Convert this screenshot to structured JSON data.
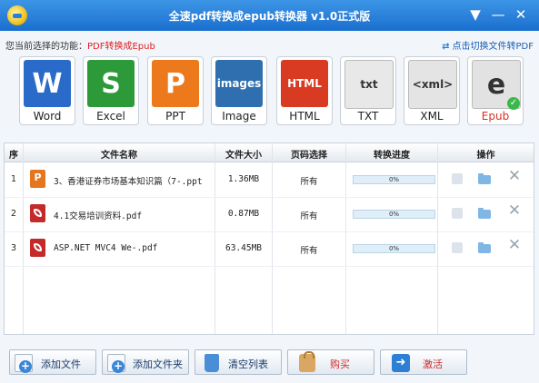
{
  "app": {
    "title": "全速pdf转换成epub转换器 v1.0正式版"
  },
  "function_bar": {
    "label": "您当前选择的功能：",
    "current": "PDF转换成Epub",
    "switch_link": "点击切换文件转PDF"
  },
  "formats": [
    {
      "name": "Word",
      "color": "#2a6bc9",
      "glyph": "W"
    },
    {
      "name": "Excel",
      "color": "#2d9a3a",
      "glyph": "S"
    },
    {
      "name": "PPT",
      "color": "#ec7a1c",
      "glyph": "P"
    },
    {
      "name": "Image",
      "color": "#2f6fb0",
      "glyph": "images"
    },
    {
      "name": "HTML",
      "color": "#d83a22",
      "glyph": "HTML"
    },
    {
      "name": "TXT",
      "color": "#e8e8e8",
      "glyph": "txt"
    },
    {
      "name": "XML",
      "color": "#e4e4e4",
      "glyph": "<xml>"
    },
    {
      "name": "Epub",
      "color": "#e2e2e2",
      "glyph": "e"
    }
  ],
  "active_format": "Epub",
  "table": {
    "headers": [
      "序",
      "文件名称",
      "文件大小",
      "页码选择",
      "转换进度",
      "操作"
    ],
    "rows": [
      {
        "index": "1",
        "type": "ppt",
        "name": "3、香港证券市场基本知识篇（7-.ppt",
        "size": "1.36MB",
        "pages": "所有",
        "progress": "0%"
      },
      {
        "index": "2",
        "type": "pdf",
        "name": "4.1交易培训资料.pdf",
        "size": "0.87MB",
        "pages": "所有",
        "progress": "0%"
      },
      {
        "index": "3",
        "type": "pdf",
        "name": "ASP.NET MVC4 We-.pdf",
        "size": "63.45MB",
        "pages": "所有",
        "progress": "0%"
      }
    ]
  },
  "buttons": {
    "add_file": "添加文件",
    "add_folder": "添加文件夹",
    "clear_list": "清空列表",
    "buy": "购买",
    "activate": "激活"
  }
}
